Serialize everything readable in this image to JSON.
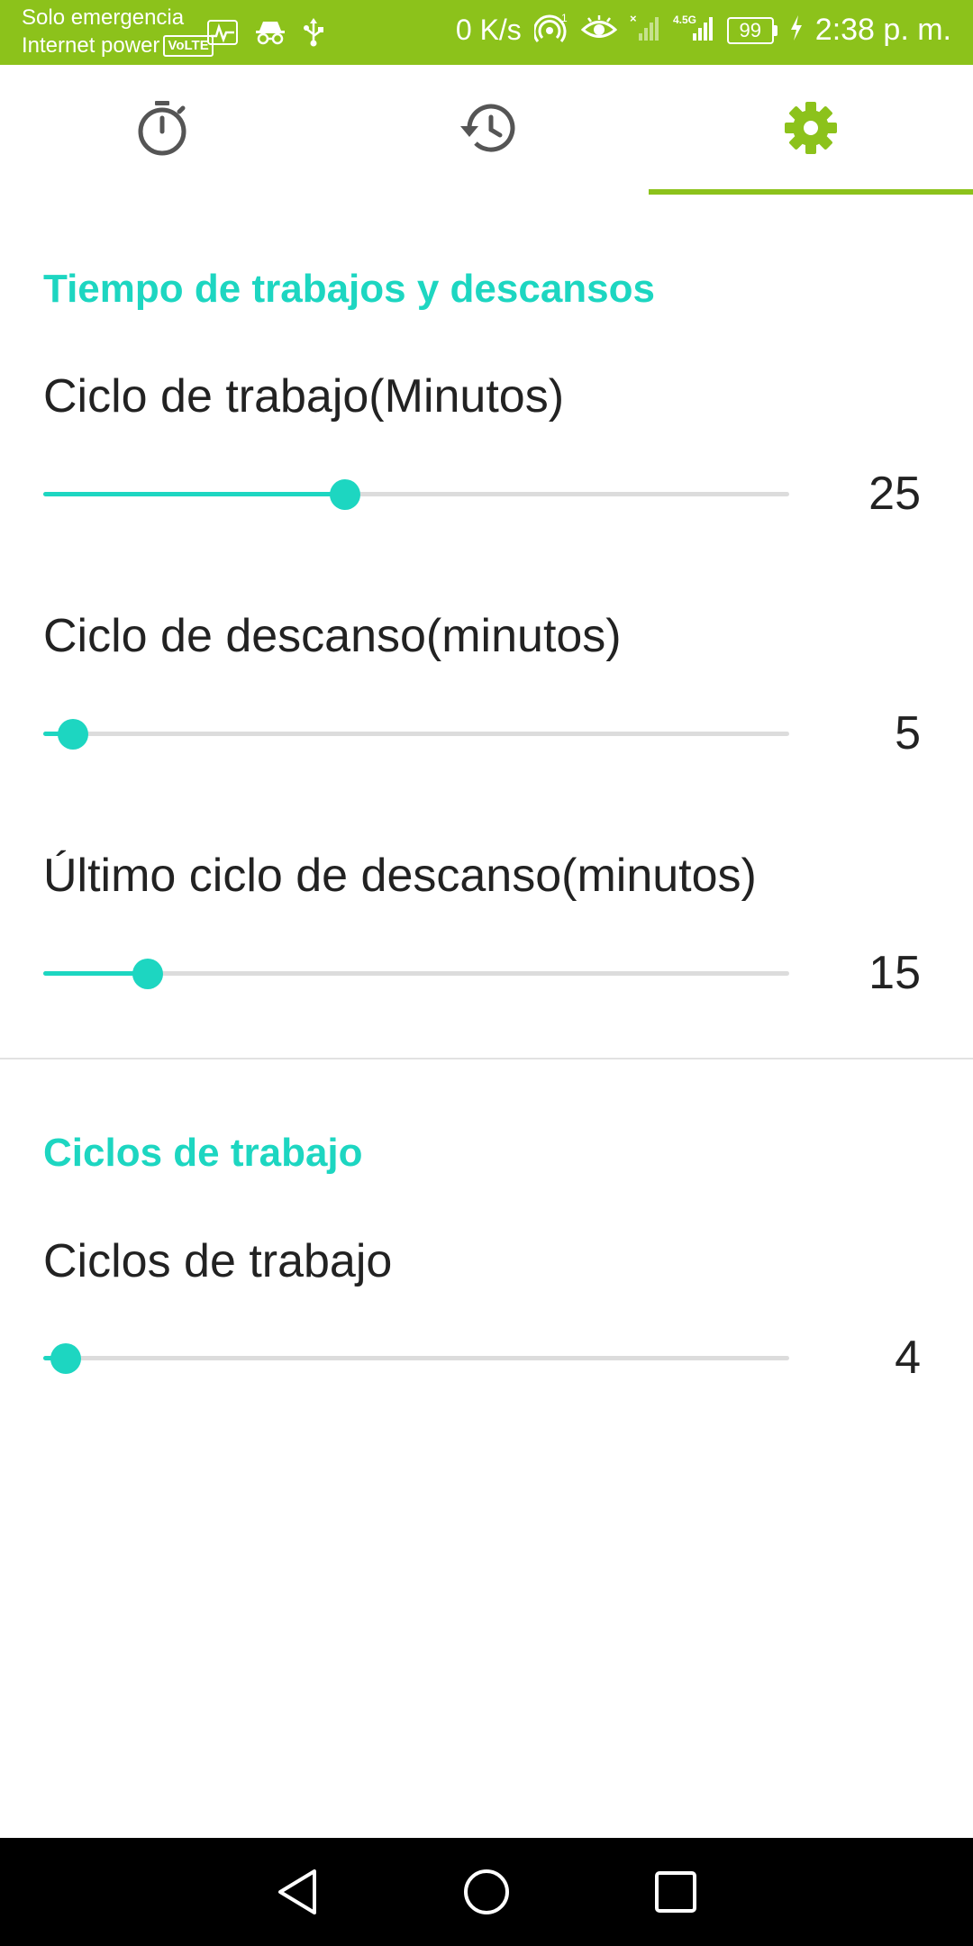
{
  "status_bar": {
    "carrier_line1": "Solo emergencia",
    "carrier_line2": "Internet power",
    "volte": "VoLTE",
    "net_speed": "0 K/s",
    "network_type": "4.5G",
    "battery": "99",
    "time": "2:38 p. m.",
    "bar_color": "#8cc21b"
  },
  "tabs": [
    {
      "icon": "timer-icon",
      "active": false
    },
    {
      "icon": "history-icon",
      "active": false
    },
    {
      "icon": "settings-gear-icon",
      "active": true
    }
  ],
  "sections": {
    "times": {
      "title": "Tiempo de trabajos y descansos",
      "work_cycle": {
        "label": "Ciclo de trabajo(Minutos)",
        "value": "25",
        "fraction": 0.405
      },
      "break_cycle": {
        "label": "Ciclo de descanso(minutos)",
        "value": "5",
        "fraction": 0.04
      },
      "last_break": {
        "label": "Último ciclo de descanso(minutos)",
        "value": "15",
        "fraction": 0.14
      }
    },
    "cycles": {
      "title": "Ciclos de trabajo",
      "work_cycles": {
        "label": "Ciclos de trabajo",
        "value": "4",
        "fraction": 0.03
      }
    }
  },
  "colors": {
    "accent": "#1dd6c1",
    "tab_indicator": "#8cc21b"
  }
}
